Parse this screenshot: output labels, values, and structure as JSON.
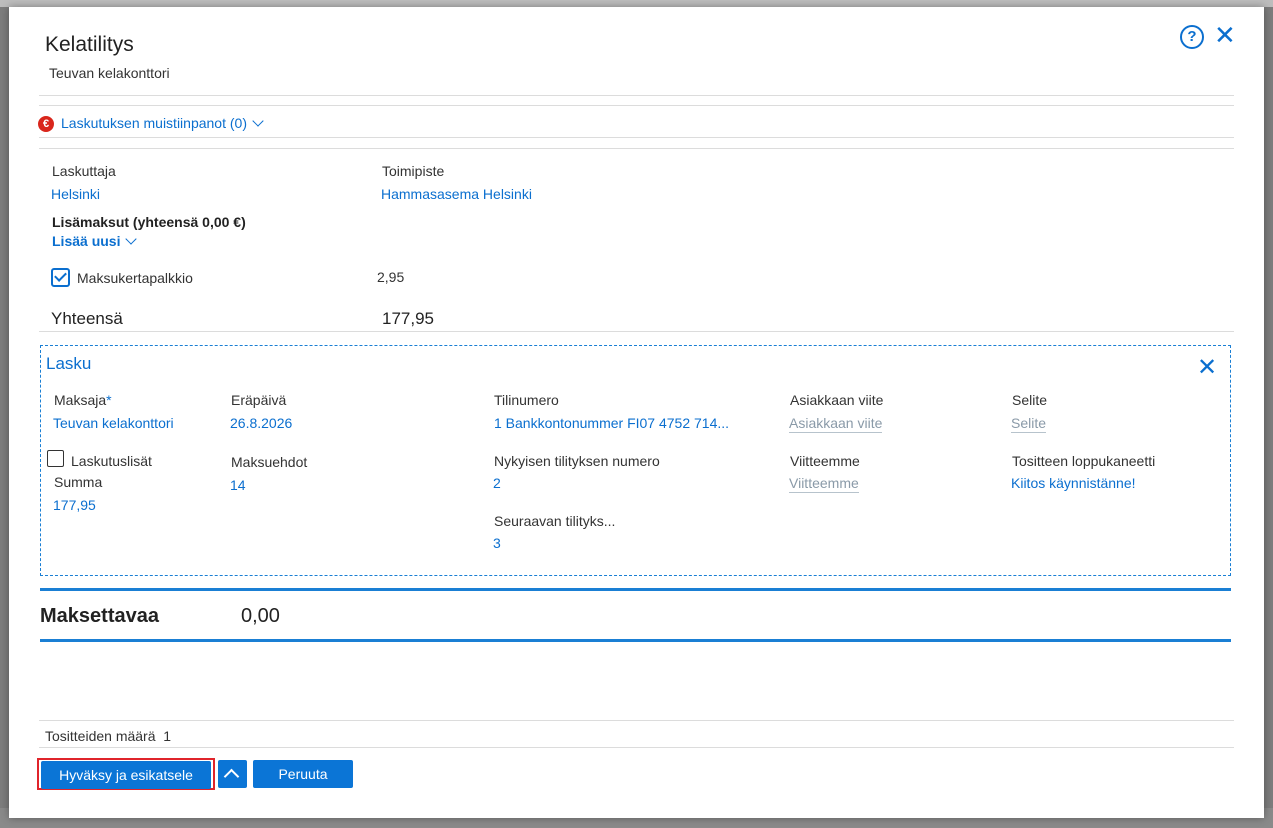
{
  "dialog": {
    "title": "Kelatilitys",
    "subtitle": "Teuvan kelakonttori",
    "help_icon": "help-circle-icon",
    "close_icon": "close-icon"
  },
  "notes": {
    "label": "Laskutuksen muistiinpanot (0)",
    "icon": "euro-icon"
  },
  "billing": {
    "biller_label": "Laskuttaja",
    "biller_value": "Helsinki",
    "office_label": "Toimipiste",
    "office_value": "Hammasasema Helsinki"
  },
  "extra_fees": {
    "title": "Lisämaksut (yhteensä 0,00 €)",
    "add_new": "Lisää uusi",
    "items": [
      {
        "label": "Maksukertapalkkio",
        "value": "2,95",
        "checked": true
      }
    ]
  },
  "total": {
    "label": "Yhteensä",
    "value": "177,95"
  },
  "invoice": {
    "title": "Lasku",
    "payer_label": "Maksaja",
    "payer_required": "*",
    "payer_value": "Teuvan kelakonttori",
    "invoice_extras_label": "Laskutuslisät",
    "sum_label": "Summa",
    "sum_value": "177,95",
    "due_date_label": "Eräpäivä",
    "due_date_value": "26.8.2026",
    "terms_label": "Maksuehdot",
    "terms_value": "14",
    "account_label": "Tilinumero",
    "account_value": "1 Bankkontonummer FI07 4752 714...",
    "current_settlement_label": "Nykyisen tilityksen numero",
    "current_settlement_value": "2",
    "next_settlement_label": "Seuraavan tilityks...",
    "next_settlement_value": "3",
    "customer_ref_label": "Asiakkaan viite",
    "customer_ref_placeholder": "Asiakkaan viite",
    "our_ref_label": "Viitteemme",
    "our_ref_placeholder": "Viitteemme",
    "description_label": "Selite",
    "description_placeholder": "Selite",
    "footer_note_label": "Tositteen loppukaneetti",
    "footer_note_value": "Kiitos käynnistänne!"
  },
  "payable": {
    "label": "Maksettavaa",
    "value": "0,00"
  },
  "footer": {
    "voucher_count_label": "Tositteiden määrä",
    "voucher_count_value": "1",
    "approve_button": "Hyväksy ja esikatsele",
    "cancel_button": "Peruuta",
    "expand_icon": "chevron-up-icon"
  },
  "colors": {
    "accent": "#0b75d6",
    "highlight_border": "#e0242b",
    "euro_badge": "#d9261c"
  }
}
